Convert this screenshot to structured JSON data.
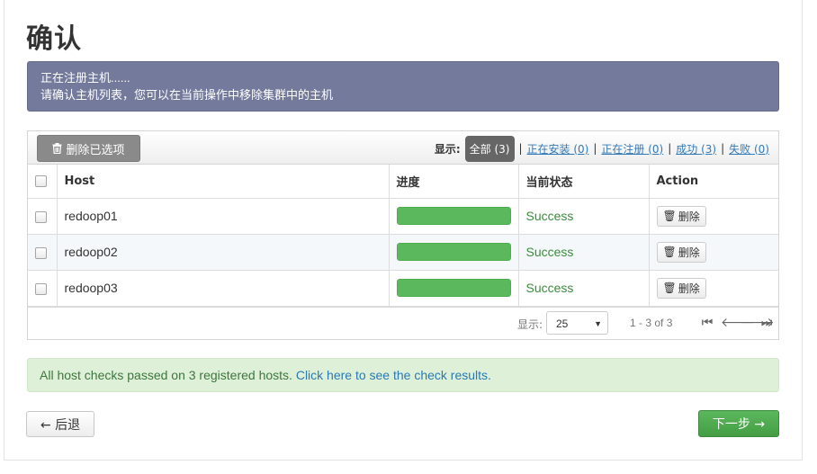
{
  "page": {
    "title": "确认"
  },
  "info": {
    "line1": "正在注册主机......",
    "line2": "请确认主机列表，您可以在当前操作中移除集群中的主机"
  },
  "toolbar": {
    "delete_selected_label": "删除已选项",
    "delete_icon": "trash-icon",
    "filter_label": "显示:",
    "filters": [
      {
        "label": "全部 (3)",
        "active": true
      },
      {
        "label": "正在安装 (0)",
        "active": false
      },
      {
        "label": "正在注册 (0)",
        "active": false
      },
      {
        "label": "成功 (3)",
        "active": false
      },
      {
        "label": "失败 (0)",
        "active": false
      }
    ],
    "separator": "|"
  },
  "table": {
    "columns": [
      "Host",
      "进度",
      "当前状态",
      "Action"
    ],
    "rows": [
      {
        "host": "redoop01",
        "progress": 1.0,
        "status": "Success",
        "action": "删除"
      },
      {
        "host": "redoop02",
        "progress": 1.0,
        "status": "Success",
        "action": "删除"
      },
      {
        "host": "redoop03",
        "progress": 1.0,
        "status": "Success",
        "action": "删除"
      }
    ]
  },
  "pager": {
    "show_label": "显示:",
    "page_size": "25",
    "range": "1 - 3 of 3",
    "icons": [
      "first-page-icon",
      "previous-page-icon",
      "next-page-icon",
      "last-page-icon"
    ]
  },
  "alert": {
    "text": "All host checks passed on 3 registered hosts.",
    "link": "Click here to see the check results."
  },
  "footer": {
    "back_label": "← 后退",
    "next_label": "下一步 →"
  },
  "colors": {
    "info_bg": "#737a9b",
    "progress": "#5cb85c",
    "success_text": "#3c8c3c",
    "next_button": "#5cb85c",
    "alert_bg": "#dff0d8"
  }
}
